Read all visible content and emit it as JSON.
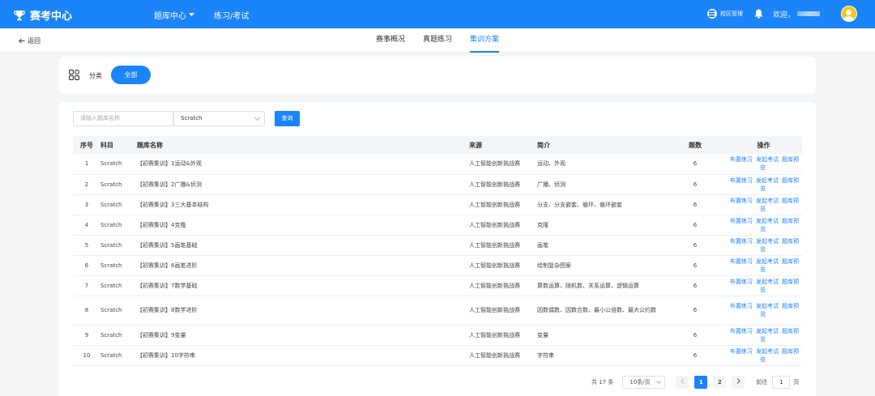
{
  "header": {
    "app_title": "赛考中心",
    "nav": [
      "题库中心",
      "练习/考试"
    ],
    "campus_label": "校区管理",
    "welcome": "欢迎，"
  },
  "subnav": {
    "back_label": "返回",
    "tabs": [
      "赛事概况",
      "真题练习",
      "集训方案"
    ],
    "active_tab": "集训方案"
  },
  "category": {
    "label": "分类",
    "all_button": "全部"
  },
  "filters": {
    "search_placeholder": "请输入题库名称",
    "subject_selected": "Scratch",
    "query_button": "查询"
  },
  "table": {
    "columns": [
      "序号",
      "科目",
      "题库名称",
      "来源",
      "简介",
      "题数",
      "操作"
    ],
    "actions": [
      "布置练习",
      "发起考试",
      "题库预览"
    ],
    "rows": [
      {
        "idx": "1",
        "subject": "Scratch",
        "name": "【初赛集训】1运动&外观",
        "source": "人工智能创新挑战赛",
        "intro": "运动、外观",
        "count": "6"
      },
      {
        "idx": "2",
        "subject": "Scratch",
        "name": "【初赛集训】2广播&侦测",
        "source": "人工智能创新挑战赛",
        "intro": "广播、侦测",
        "count": "6"
      },
      {
        "idx": "3",
        "subject": "Scratch",
        "name": "【初赛集训】3三大基本结构",
        "source": "人工智能创新挑战赛",
        "intro": "分支、分支嵌套、循环、循环嵌套",
        "count": "6"
      },
      {
        "idx": "4",
        "subject": "Scratch",
        "name": "【初赛集训】4克隆",
        "source": "人工智能创新挑战赛",
        "intro": "克隆",
        "count": "6"
      },
      {
        "idx": "5",
        "subject": "Scratch",
        "name": "【初赛集训】5画笔基础",
        "source": "人工智能创新挑战赛",
        "intro": "画笔",
        "count": "6"
      },
      {
        "idx": "6",
        "subject": "Scratch",
        "name": "【初赛集训】6画笔进阶",
        "source": "人工智能创新挑战赛",
        "intro": "绘制复杂图案",
        "count": "6"
      },
      {
        "idx": "7",
        "subject": "Scratch",
        "name": "【初赛集训】7数学基础",
        "source": "人工智能创新挑战赛",
        "intro": "算数运算、随机数、关系运算、逻辑运算",
        "count": "6"
      },
      {
        "idx": "8",
        "subject": "Scratch",
        "name": "【初赛集训】8数学进阶",
        "source": "人工智能创新挑战赛",
        "intro": "因数偶数、因数合数、最小公倍数、最大公约数",
        "count": "6"
      },
      {
        "idx": "9",
        "subject": "Scratch",
        "name": "【初赛集训】9变量",
        "source": "人工智能创新挑战赛",
        "intro": "变量",
        "count": "6"
      },
      {
        "idx": "10",
        "subject": "Scratch",
        "name": "【初赛集训】10字符串",
        "source": "人工智能创新挑战赛",
        "intro": "字符串",
        "count": "6"
      }
    ]
  },
  "pagination": {
    "total": "共 17 条",
    "page_size": "10条/页",
    "pages": [
      "1",
      "2"
    ],
    "current": "1",
    "goto_label": "前往",
    "goto_value": "1",
    "goto_unit": "页"
  },
  "colors": {
    "primary": "#1a84f8"
  }
}
